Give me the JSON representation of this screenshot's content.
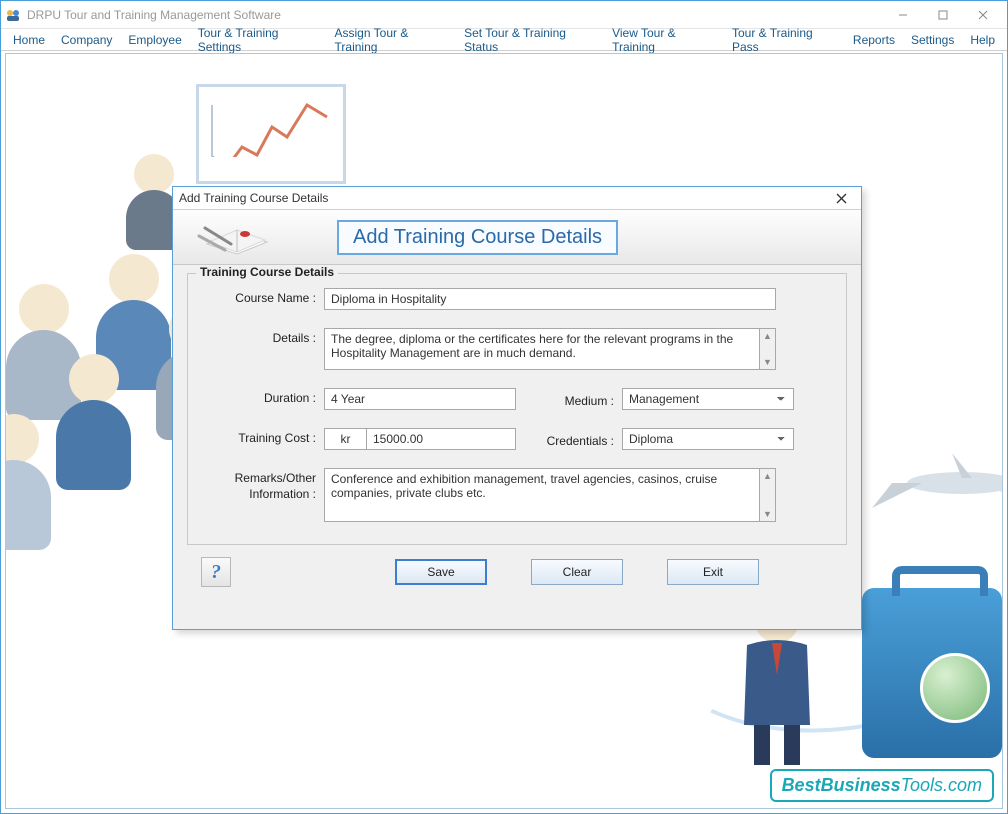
{
  "app": {
    "title": "DRPU Tour and Training Management Software"
  },
  "menu": {
    "items": [
      "Home",
      "Company",
      "Employee",
      "Tour & Training Settings",
      "Assign Tour & Training",
      "Set Tour & Training Status",
      "View Tour & Training",
      "Tour & Training Pass",
      "Reports",
      "Settings",
      "Help"
    ]
  },
  "dialog": {
    "window_title": "Add Training Course Details",
    "heading": "Add Training Course Details",
    "fieldset_legend": "Training Course Details",
    "labels": {
      "course_name": "Course Name :",
      "details": "Details :",
      "duration": "Duration :",
      "medium": "Medium :",
      "training_cost": "Training Cost :",
      "credentials": "Credentials :",
      "remarks_line1": "Remarks/Other",
      "remarks_line2": "Information :"
    },
    "values": {
      "course_name": "Diploma in Hospitality",
      "details": "The degree, diploma or the certificates here for the relevant programs in the Hospitality Management are in much demand.",
      "duration": "4 Year",
      "medium": "Management",
      "currency": "kr",
      "training_cost": "15000.00",
      "credentials": "Diploma",
      "remarks": "Conference and exhibition management, travel agencies, casinos, cruise companies, private clubs etc."
    },
    "buttons": {
      "save": "Save",
      "clear": "Clear",
      "exit": "Exit"
    }
  },
  "watermark": {
    "bold": "BestBusiness",
    "light": "Tools.com"
  }
}
